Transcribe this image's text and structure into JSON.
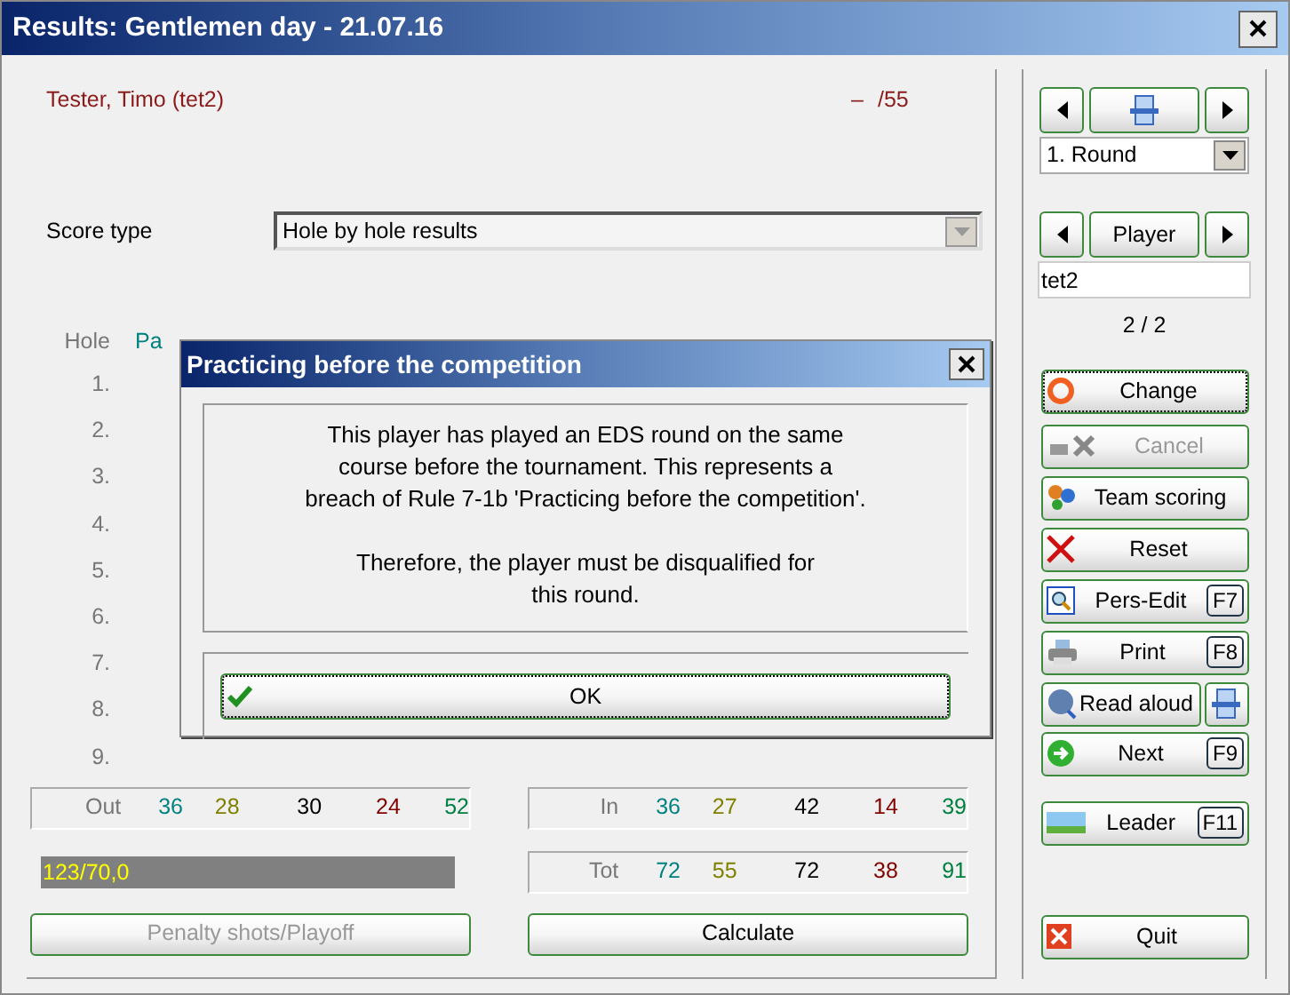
{
  "window": {
    "title": "Results: Gentlemen day - 21.07.16"
  },
  "player_line": {
    "name": "Tester, Timo (tet2)",
    "dash": "–",
    "score": "/55"
  },
  "score_type": {
    "label": "Score type",
    "value": "Hole by hole results"
  },
  "holes": {
    "header": "Hole",
    "par_header": "Pa",
    "numbers": [
      "1.",
      "2.",
      "3.",
      "4.",
      "5.",
      "6.",
      "7.",
      "8.",
      "9."
    ]
  },
  "totals": [
    {
      "label": "Out",
      "values": [
        {
          "text": "36",
          "color": "#008080"
        },
        {
          "text": "28",
          "color": "#808000"
        },
        {
          "text": "30",
          "color": "#000000"
        },
        {
          "text": "24",
          "color": "#800000"
        },
        {
          "text": "52",
          "color": "#008040"
        }
      ]
    },
    {
      "label": "In",
      "values": [
        {
          "text": "36",
          "color": "#008080"
        },
        {
          "text": "27",
          "color": "#808000"
        },
        {
          "text": "42",
          "color": "#000000"
        },
        {
          "text": "14",
          "color": "#800000"
        },
        {
          "text": "39",
          "color": "#008040"
        }
      ]
    },
    {
      "label": "Tot",
      "values": [
        {
          "text": "72",
          "color": "#008080"
        },
        {
          "text": "55",
          "color": "#808000"
        },
        {
          "text": "72",
          "color": "#000000"
        },
        {
          "text": "38",
          "color": "#800000"
        },
        {
          "text": "91",
          "color": "#008040"
        }
      ]
    }
  ],
  "progress": {
    "text": "123/70,0"
  },
  "bottom_buttons": [
    {
      "label": "Penalty shots/Playoff",
      "disabled": true
    },
    {
      "label": "Calculate",
      "disabled": false
    }
  ],
  "round_nav": {
    "round": "1. Round"
  },
  "player_nav": {
    "label": "Player",
    "value": "tet2",
    "count": "2 / 2"
  },
  "side_buttons": [
    {
      "label": "Change",
      "disabled": false,
      "focused": true
    },
    {
      "label": "Cancel",
      "disabled": true,
      "focused": false
    },
    {
      "label": "Team scoring",
      "disabled": false,
      "focused": false
    },
    {
      "label": "Reset",
      "disabled": false,
      "focused": false
    },
    {
      "label": "Pers-Edit",
      "key": "F7",
      "disabled": false,
      "focused": false
    },
    {
      "label": "Print",
      "key": "F8",
      "disabled": false,
      "focused": false
    },
    {
      "label": "Read aloud",
      "disabled": false,
      "focused": false
    },
    {
      "label": "Next",
      "key": "F9",
      "disabled": false,
      "focused": false
    },
    {
      "label": "Leader",
      "key": "F11",
      "disabled": false,
      "focused": false
    },
    {
      "label": "Quit",
      "disabled": false,
      "focused": false
    }
  ],
  "dialog": {
    "title": "Practicing before the competition",
    "paragraphs": [
      [
        "This player has played an EDS round on the same",
        "course before the tournament. This represents a",
        "breach of Rule 7-1b 'Practicing before the competition'."
      ],
      [
        "Therefore, the player must be disqualified for",
        "this round."
      ]
    ],
    "ok": "OK"
  }
}
